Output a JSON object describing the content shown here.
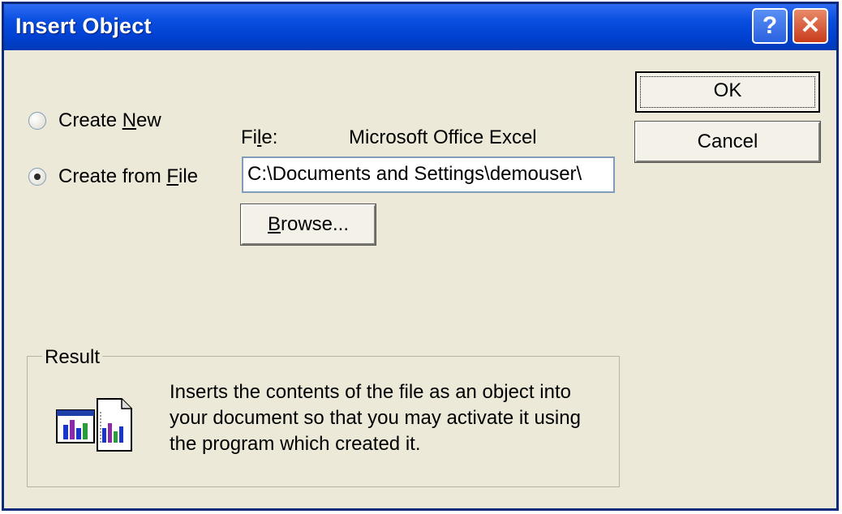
{
  "window": {
    "title": "Insert Object",
    "help_glyph": "?",
    "close_glyph": "✕"
  },
  "options": {
    "create_new": {
      "pre": "Create ",
      "key": "N",
      "post": "ew"
    },
    "create_from_file": {
      "pre": "Create from ",
      "key": "F",
      "post": "ile"
    }
  },
  "file": {
    "label_pre": "Fi",
    "label_key": "l",
    "label_post": "e:",
    "type": "Microsoft Office Excel",
    "path": "C:\\Documents and Settings\\demouser\\"
  },
  "buttons": {
    "ok": "OK",
    "cancel": "Cancel",
    "browse_key": "B",
    "browse_post": "rowse..."
  },
  "result": {
    "label": "Result",
    "text": "Inserts the contents of the file as an object into your document so that you may activate it using the program which created it.",
    "icon": "insert-object-file-icon"
  }
}
